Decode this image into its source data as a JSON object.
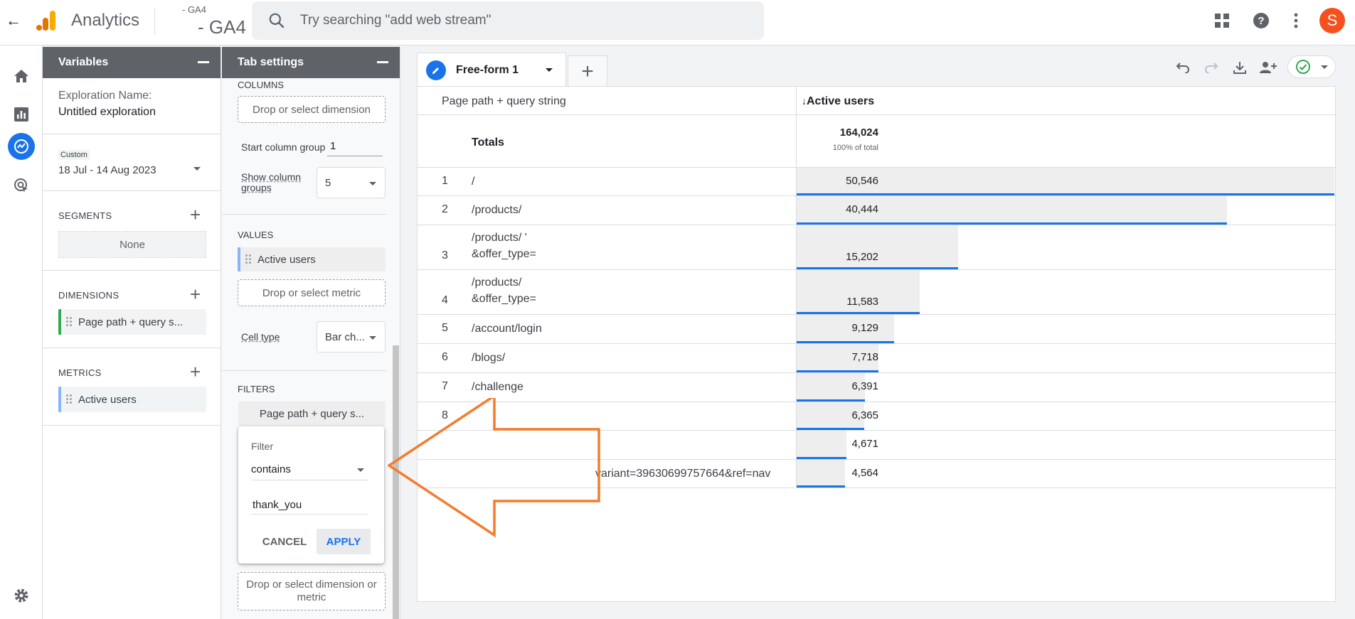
{
  "header": {
    "app_name": "Analytics",
    "account_small": "- GA4",
    "account_big": "- GA4",
    "search_placeholder": "Try searching \"add web stream\"",
    "avatar_letter": "S"
  },
  "variables_panel": {
    "title": "Variables",
    "exploration_name_label": "Exploration Name:",
    "exploration_name": "Untitled exploration",
    "date_tag": "Custom",
    "date_range": "18 Jul - 14 Aug 2023",
    "segments_title": "SEGMENTS",
    "segments_value": "None",
    "dimensions_title": "DIMENSIONS",
    "dimension_chip": "Page path + query s...",
    "metrics_title": "METRICS",
    "metric_chip": "Active users"
  },
  "tab_settings": {
    "title": "Tab settings",
    "columns_title": "COLUMNS",
    "columns_drop": "Drop or select dimension",
    "start_column_group_label": "Start column group",
    "start_column_group_value": "1",
    "show_column_groups_label": "Show column groups",
    "show_column_groups_value": "5",
    "values_title": "VALUES",
    "values_chip": "Active users",
    "values_drop": "Drop or select metric",
    "cell_type_label": "Cell type",
    "cell_type_value": "Bar ch...",
    "filters_title": "FILTERS",
    "filter_chip": "Page path + query s...",
    "filters_drop": "Drop or select dimension or metric"
  },
  "filter_popup": {
    "label": "Filter",
    "match_type": "contains",
    "value": "thank_you",
    "cancel": "CANCEL",
    "apply": "APPLY"
  },
  "canvas": {
    "tab_name": "Free-form 1",
    "dimension_header": "Page path + query string",
    "metric_header": "Active users",
    "sort_arrow": "↓",
    "totals_label": "Totals",
    "totals_value": "164,024",
    "totals_pct": "100% of total",
    "max_value": 50546,
    "rows": [
      {
        "idx": "1",
        "path": "/",
        "path2": "",
        "value": "50,546",
        "n": 50546
      },
      {
        "idx": "2",
        "path": "/products/",
        "path2": "",
        "value": "40,444",
        "n": 40444
      },
      {
        "idx": "3",
        "path": "/products/ '",
        "path2": "&offer_type=",
        "value": "15,202",
        "n": 15202
      },
      {
        "idx": "4",
        "path": "/products/",
        "path2": "&offer_type=",
        "value": "11,583",
        "n": 11583
      },
      {
        "idx": "5",
        "path": "/account/login",
        "path2": "",
        "value": "9,129",
        "n": 9129
      },
      {
        "idx": "6",
        "path": "/blogs/",
        "path2": "",
        "value": "7,718",
        "n": 7718
      },
      {
        "idx": "7",
        "path": "/challenge",
        "path2": "",
        "value": "6,391",
        "n": 6391
      },
      {
        "idx": "8",
        "path": "",
        "path2": "",
        "value": "6,365",
        "n": 6365
      },
      {
        "idx": "",
        "path": "",
        "path2": "",
        "value": "4,671",
        "n": 4671
      },
      {
        "idx": "",
        "path": "variant=39630699757664&ref=nav",
        "path2": "",
        "value": "4,564",
        "n": 4564
      }
    ]
  },
  "colors": {
    "accent": "#1a73e8",
    "panel_header": "#5f6368",
    "dimension_chip_border": "#34a853",
    "metric_chip_border": "#8ab4f8",
    "annotation_arrow": "#f47c2c",
    "avatar": "#f4511e"
  }
}
